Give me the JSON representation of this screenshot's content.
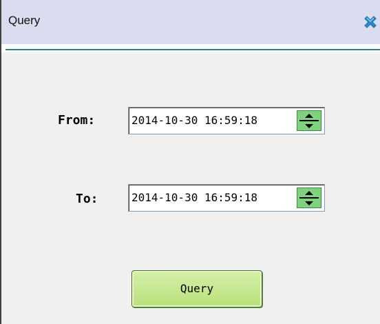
{
  "window": {
    "title": "Query",
    "close_icon": "close-icon",
    "accent_color": "#2f7f7f",
    "close_color": "#2a8ad0"
  },
  "form": {
    "from_label": "From:",
    "from_value": "2014-10-30 16:59:18",
    "to_label": "To:",
    "to_value": "2014-10-30 16:59:18",
    "spinner_color": "#7fd27f"
  },
  "actions": {
    "query_label": "Query"
  }
}
